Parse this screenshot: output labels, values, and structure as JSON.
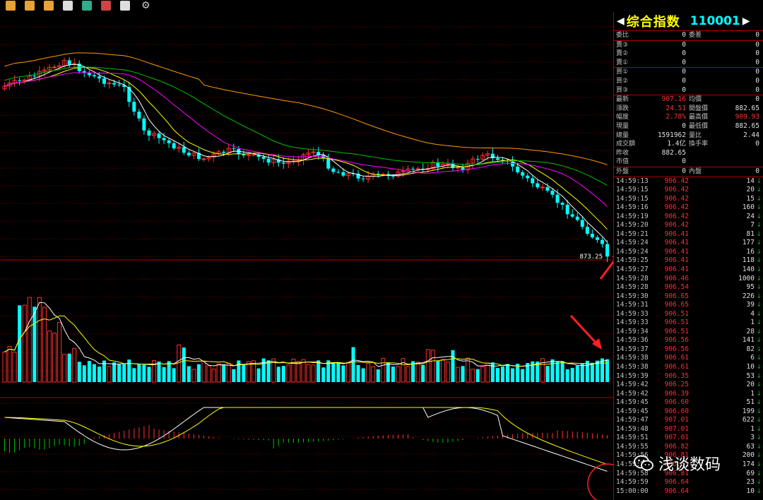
{
  "header": {
    "arrow_left": "◀",
    "name": "综合指数",
    "code": "110001",
    "arrow_right": "▶"
  },
  "quote": {
    "bid_ask": [
      {
        "label": "委比",
        "value": "0",
        "label2": "委差",
        "value2": "0"
      }
    ],
    "sell": [
      {
        "label": "賣③",
        "price": "0",
        "vol": "0"
      },
      {
        "label": "賣②",
        "price": "0",
        "vol": "0"
      },
      {
        "label": "賣①",
        "price": "0",
        "vol": "0"
      }
    ],
    "buy": [
      {
        "label": "買①",
        "price": "0",
        "vol": "0"
      },
      {
        "label": "買②",
        "price": "0",
        "vol": "0"
      },
      {
        "label": "買③",
        "price": "0",
        "vol": "0"
      }
    ],
    "stats": [
      {
        "label": "最新",
        "value": "907.16",
        "vc": "red",
        "label2": "均價",
        "value2": "0",
        "v2c": "wht"
      },
      {
        "label": "漲跌",
        "value": "24.51",
        "vc": "red",
        "label2": "開盤價",
        "value2": "882.65",
        "v2c": "wht"
      },
      {
        "label": "幅度",
        "value": "2.78%",
        "vc": "red",
        "label2": "最高價",
        "value2": "909.93",
        "v2c": "red"
      },
      {
        "label": "現量",
        "value": "0",
        "vc": "wht",
        "label2": "最低價",
        "value2": "882.65",
        "v2c": "wht"
      },
      {
        "label": "總量",
        "value": "1591962",
        "vc": "wht",
        "label2": "量比",
        "value2": "2.44",
        "v2c": "wht"
      },
      {
        "label": "成交額",
        "value": "1.4亿",
        "vc": "wht",
        "label2": "換手率",
        "value2": "0",
        "v2c": "wht"
      },
      {
        "label": "昨收",
        "value": "882.65",
        "vc": "wht",
        "label2": "",
        "value2": "",
        "v2c": "wht"
      },
      {
        "label": "市值",
        "value": "0",
        "vc": "wht",
        "label2": "",
        "value2": "",
        "v2c": "wht"
      }
    ],
    "inout": {
      "label": "外盤",
      "value": "0",
      "label2": "內盤",
      "value2": "0"
    }
  },
  "ticks": [
    {
      "time": "14:59:13",
      "price": "906.42",
      "vol": "14",
      "dir": "↓"
    },
    {
      "time": "14:59:15",
      "price": "906.42",
      "vol": "20",
      "dir": "↓"
    },
    {
      "time": "14:59:15",
      "price": "906.42",
      "vol": "15",
      "dir": "↓"
    },
    {
      "time": "14:59:16",
      "price": "906.42",
      "vol": "160",
      "dir": "↓"
    },
    {
      "time": "14:59:19",
      "price": "906.42",
      "vol": "24",
      "dir": "↓"
    },
    {
      "time": "14:59:20",
      "price": "906.42",
      "vol": "7",
      "dir": "↓"
    },
    {
      "time": "14:59:21",
      "price": "906.41",
      "vol": "81",
      "dir": "↓"
    },
    {
      "time": "14:59:24",
      "price": "906.41",
      "vol": "177",
      "dir": "↓"
    },
    {
      "time": "14:59:24",
      "price": "906.41",
      "vol": "16",
      "dir": "↓"
    },
    {
      "time": "14:59:25",
      "price": "906.41",
      "vol": "118",
      "dir": "↓"
    },
    {
      "time": "14:59:27",
      "price": "906.41",
      "vol": "140",
      "dir": "↓"
    },
    {
      "time": "14:59:28",
      "price": "906.46",
      "vol": "1000",
      "dir": "↓"
    },
    {
      "time": "14:59:28",
      "price": "906.54",
      "vol": "95",
      "dir": "↓"
    },
    {
      "time": "14:59:30",
      "price": "906.65",
      "vol": "226",
      "dir": "↓"
    },
    {
      "time": "14:59:31",
      "price": "906.65",
      "vol": "39",
      "dir": "↓"
    },
    {
      "time": "14:59:33",
      "price": "906.51",
      "vol": "4",
      "dir": "↓"
    },
    {
      "time": "14:59:33",
      "price": "906.51",
      "vol": "1",
      "dir": "↓"
    },
    {
      "time": "14:59:34",
      "price": "906.51",
      "vol": "28",
      "dir": "↓"
    },
    {
      "time": "14:59:36",
      "price": "906.56",
      "vol": "141",
      "dir": "↓"
    },
    {
      "time": "14:59:37",
      "price": "906.56",
      "vol": "82",
      "dir": "↓"
    },
    {
      "time": "14:59:38",
      "price": "906.61",
      "vol": "6",
      "dir": "↓"
    },
    {
      "time": "14:59:38",
      "price": "906.61",
      "vol": "10",
      "dir": "↓"
    },
    {
      "time": "14:59:39",
      "price": "906.35",
      "vol": "53",
      "dir": "↓"
    },
    {
      "time": "14:59:42",
      "price": "906.25",
      "vol": "20",
      "dir": "↓"
    },
    {
      "time": "14:59:42",
      "price": "906.39",
      "vol": "1",
      "dir": "↓"
    },
    {
      "time": "14:59:45",
      "price": "906.60",
      "vol": "51",
      "dir": "↓"
    },
    {
      "time": "14:59:45",
      "price": "906.60",
      "vol": "199",
      "dir": "↓"
    },
    {
      "time": "14:59:47",
      "price": "907.01",
      "vol": "622",
      "dir": "↓"
    },
    {
      "time": "14:59:48",
      "price": "907.01",
      "vol": "1",
      "dir": "↓"
    },
    {
      "time": "14:59:51",
      "price": "907.01",
      "vol": "3",
      "dir": "↓"
    },
    {
      "time": "14:59:55",
      "price": "906.82",
      "vol": "63",
      "dir": "↓"
    },
    {
      "time": "14:59:56",
      "price": "906.81",
      "vol": "200",
      "dir": "↓"
    },
    {
      "time": "14:59:57",
      "price": "906.81",
      "vol": "174",
      "dir": "↓"
    },
    {
      "time": "14:59:58",
      "price": "906.81",
      "vol": "69",
      "dir": "↓"
    },
    {
      "time": "14:59:59",
      "price": "906.64",
      "vol": "23",
      "dir": "↓"
    },
    {
      "time": "15:00:00",
      "price": "906.64",
      "vol": "10",
      "dir": "↓"
    }
  ],
  "chart_label": "873.25",
  "watermark": "浅谈数码",
  "colors": {
    "up": "#ff3030",
    "down": "#00ffff",
    "grid": "#8b0000",
    "ma5": "#ffffff",
    "ma10": "#ffff00",
    "ma20": "#ff00ff",
    "ma30": "#00c000",
    "ma60": "#ff9900"
  },
  "toolbar": [
    "bar-chart-icon",
    "calendar-icon",
    "filter-icon",
    "copy-icon",
    "zoom-in-icon",
    "zoom-out-icon",
    "edit-icon",
    "gear-icon"
  ]
}
